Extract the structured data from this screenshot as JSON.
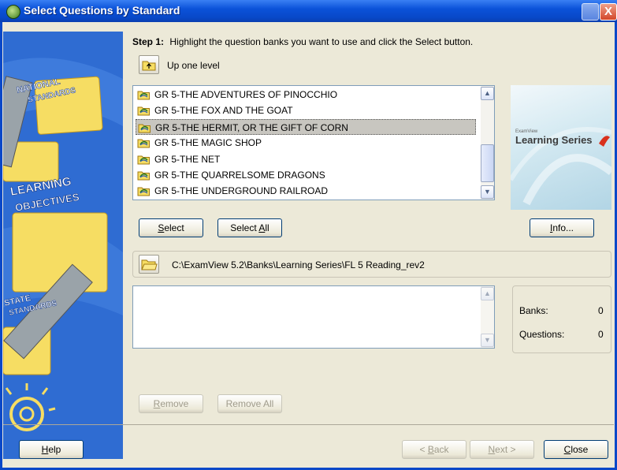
{
  "window": {
    "title": "Select Questions by Standard",
    "close_glyph": "X"
  },
  "step": {
    "label": "Step 1:",
    "text": "Highlight the question banks you want to use and click the Select button."
  },
  "up_level": {
    "label": "Up one level"
  },
  "banks": [
    {
      "label": "GR 5-THE ADVENTURES OF PINOCCHIO",
      "selected": false
    },
    {
      "label": "GR 5-THE FOX AND THE GOAT",
      "selected": false
    },
    {
      "label": "GR 5-THE HERMIT, OR THE GIFT OF CORN",
      "selected": true
    },
    {
      "label": "GR 5-THE MAGIC SHOP",
      "selected": false
    },
    {
      "label": "GR 5-THE NET",
      "selected": false
    },
    {
      "label": "GR 5-THE QUARRELSOME DRAGONS",
      "selected": false
    },
    {
      "label": "GR 5-THE UNDERGROUND RAILROAD",
      "selected": false
    }
  ],
  "buttons": {
    "select": {
      "pre": "",
      "ul": "S",
      "post": "elect"
    },
    "select_all": {
      "pre": "Select ",
      "ul": "A",
      "post": "ll"
    },
    "info": {
      "pre": "",
      "ul": "I",
      "post": "nfo..."
    },
    "remove": {
      "pre": "",
      "ul": "R",
      "post": "emove"
    },
    "remove_all": {
      "pre": "Remove All",
      "ul": "",
      "post": ""
    },
    "help": {
      "pre": "",
      "ul": "H",
      "post": "elp"
    },
    "back": {
      "pre": "< ",
      "ul": "B",
      "post": "ack"
    },
    "next": {
      "pre": "",
      "ul": "N",
      "post": "ext >"
    },
    "close": {
      "pre": "",
      "ul": "C",
      "post": "lose"
    }
  },
  "path": {
    "value": "C:\\ExamView 5.2\\Banks\\Learning Series\\FL 5 Reading_rev2"
  },
  "stats": {
    "banks_label": "Banks:",
    "banks_value": "0",
    "questions_label": "Questions:",
    "questions_value": "0"
  },
  "logo": {
    "small": "ExamView",
    "big": "Learning Series"
  },
  "sidebar": {
    "national": [
      "NATIONAL",
      "STANDARDS"
    ],
    "learning": [
      "LEARNING",
      "OBJECTIVES"
    ],
    "state": [
      "STATE",
      "STANDARDS"
    ]
  },
  "colors": {
    "titlebar": "#0a48c8",
    "sidebar_bg": "#2f6cd2",
    "folder_yellow": "#f6dd63",
    "selection": "#c8c6c0"
  }
}
